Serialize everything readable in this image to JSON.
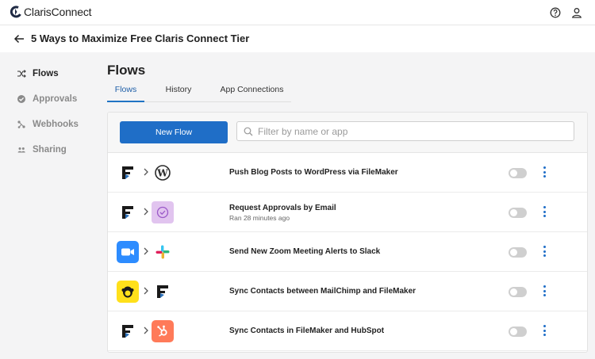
{
  "header": {
    "brand_a": "Claris",
    "brand_b": "Connect",
    "help_icon": "help-circle-icon",
    "account_icon": "user-icon"
  },
  "page": {
    "title": "5 Ways to Maximize Free Claris Connect Tier"
  },
  "sidebar": {
    "items": [
      {
        "label": "Flows",
        "icon": "shuffle-icon",
        "active": true
      },
      {
        "label": "Approvals",
        "icon": "check-circle-icon",
        "active": false
      },
      {
        "label": "Webhooks",
        "icon": "webhook-icon",
        "active": false
      },
      {
        "label": "Sharing",
        "icon": "people-icon",
        "active": false
      }
    ]
  },
  "main": {
    "title": "Flows",
    "tabs": [
      {
        "label": "Flows",
        "active": true
      },
      {
        "label": "History",
        "active": false
      },
      {
        "label": "App Connections",
        "active": false
      }
    ],
    "new_flow_label": "New Flow",
    "search_placeholder": "Filter by name or app"
  },
  "flows": [
    {
      "name": "Push Blog Posts to WordPress via FileMaker",
      "subtitle": "",
      "from": "filemaker",
      "to": "wordpress",
      "enabled": false
    },
    {
      "name": "Request Approvals by Email",
      "subtitle": "Ran 28 minutes ago",
      "from": "filemaker",
      "to": "approvals",
      "enabled": false
    },
    {
      "name": "Send New Zoom Meeting Alerts to Slack",
      "subtitle": "",
      "from": "zoom",
      "to": "slack",
      "enabled": false
    },
    {
      "name": "Sync Contacts between MailChimp and FileMaker",
      "subtitle": "",
      "from": "mailchimp",
      "to": "filemaker",
      "enabled": false
    },
    {
      "name": "Sync Contacts in FileMaker and HubSpot",
      "subtitle": "",
      "from": "filemaker",
      "to": "hubspot",
      "enabled": false
    }
  ],
  "colors": {
    "primary": "#1f6ec7",
    "zoom": "#2d8cff",
    "mailchimp": "#ffe01b",
    "hubspot": "#ff7a59",
    "approvals": "#e1c4ef"
  }
}
